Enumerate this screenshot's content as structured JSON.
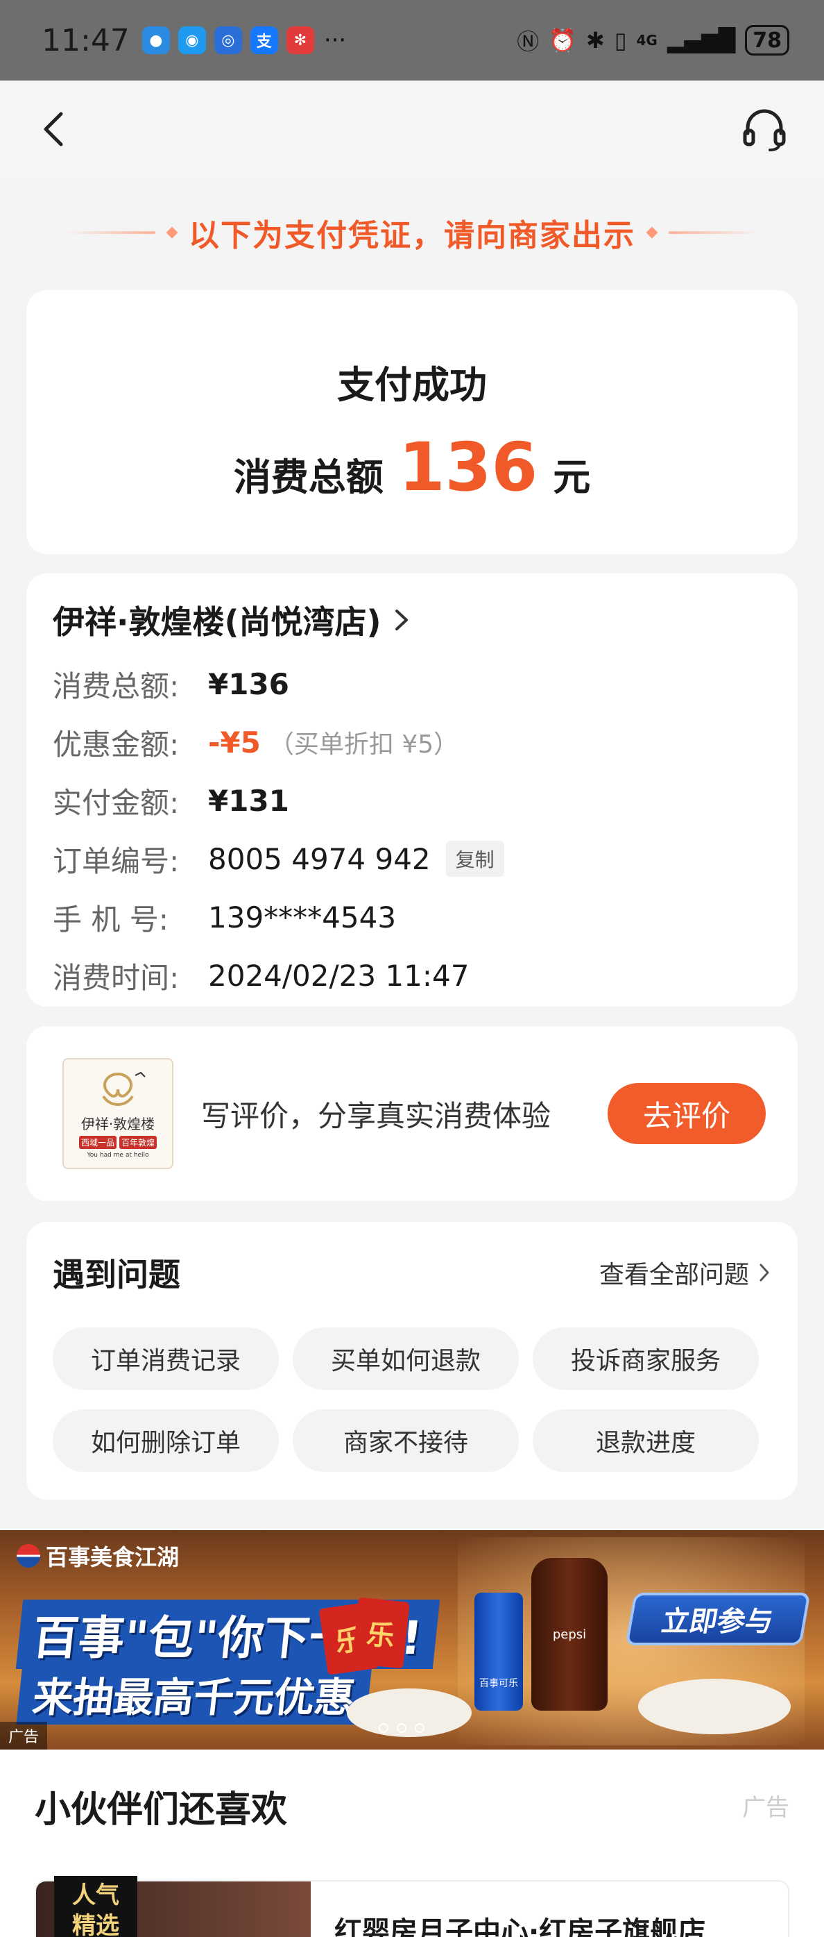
{
  "status_bar": {
    "time": "11:47",
    "network": "4G",
    "battery": "78",
    "more": "···"
  },
  "voucher_banner": {
    "text": "以下为支付凭证，请向商家出示"
  },
  "success": {
    "title": "支付成功",
    "total_label": "消费总额",
    "total_amount": "136",
    "unit": "元"
  },
  "order": {
    "shop_name": "伊祥·敦煌楼(尚悦湾店)",
    "rows": [
      {
        "label": "消费总额:",
        "value": "¥136"
      },
      {
        "label": "优惠金额:",
        "value": "-¥5",
        "note": "（买单折扣 ¥5）"
      },
      {
        "label": "实付金额:",
        "value": "¥131"
      },
      {
        "label": "订单编号:",
        "value": "8005 4974 942",
        "action": "复制"
      },
      {
        "label": "手 机 号:",
        "value": "139****4543"
      },
      {
        "label": "消费时间:",
        "value": "2024/02/23 11:47"
      }
    ]
  },
  "review": {
    "logo_brand": "伊祥·敦煌楼",
    "logo_tags": [
      "西域一品",
      "百年敦煌"
    ],
    "logo_sub": "You had me at hello",
    "prompt": "写评价，分享真实消费体验",
    "button": "去评价"
  },
  "faq": {
    "title": "遇到问题",
    "view_all": "查看全部问题",
    "items": [
      "订单消费记录",
      "买单如何退款",
      "投诉商家服务",
      "如何删除订单",
      "商家不接待",
      "退款进度"
    ]
  },
  "ad_banner": {
    "brand": "百事美食江湖",
    "line1": "百事\"包\"你下一餐!",
    "line2": "来抽最高千元优惠",
    "cta": "立即参与",
    "tag": "广告",
    "env_char": "乐",
    "can_text": "百事可乐",
    "bottle_text": "pepsi"
  },
  "recommend": {
    "title": "小伙伴们还喜欢",
    "ad_label": "广告",
    "badge_line1": "人气",
    "badge_line2": "精选",
    "item_name": "红婴房月子中心·红房子旗舰店"
  },
  "colors": {
    "accent": "#f05a28",
    "button": "#f25c2b",
    "background": "#f4f4f4"
  }
}
